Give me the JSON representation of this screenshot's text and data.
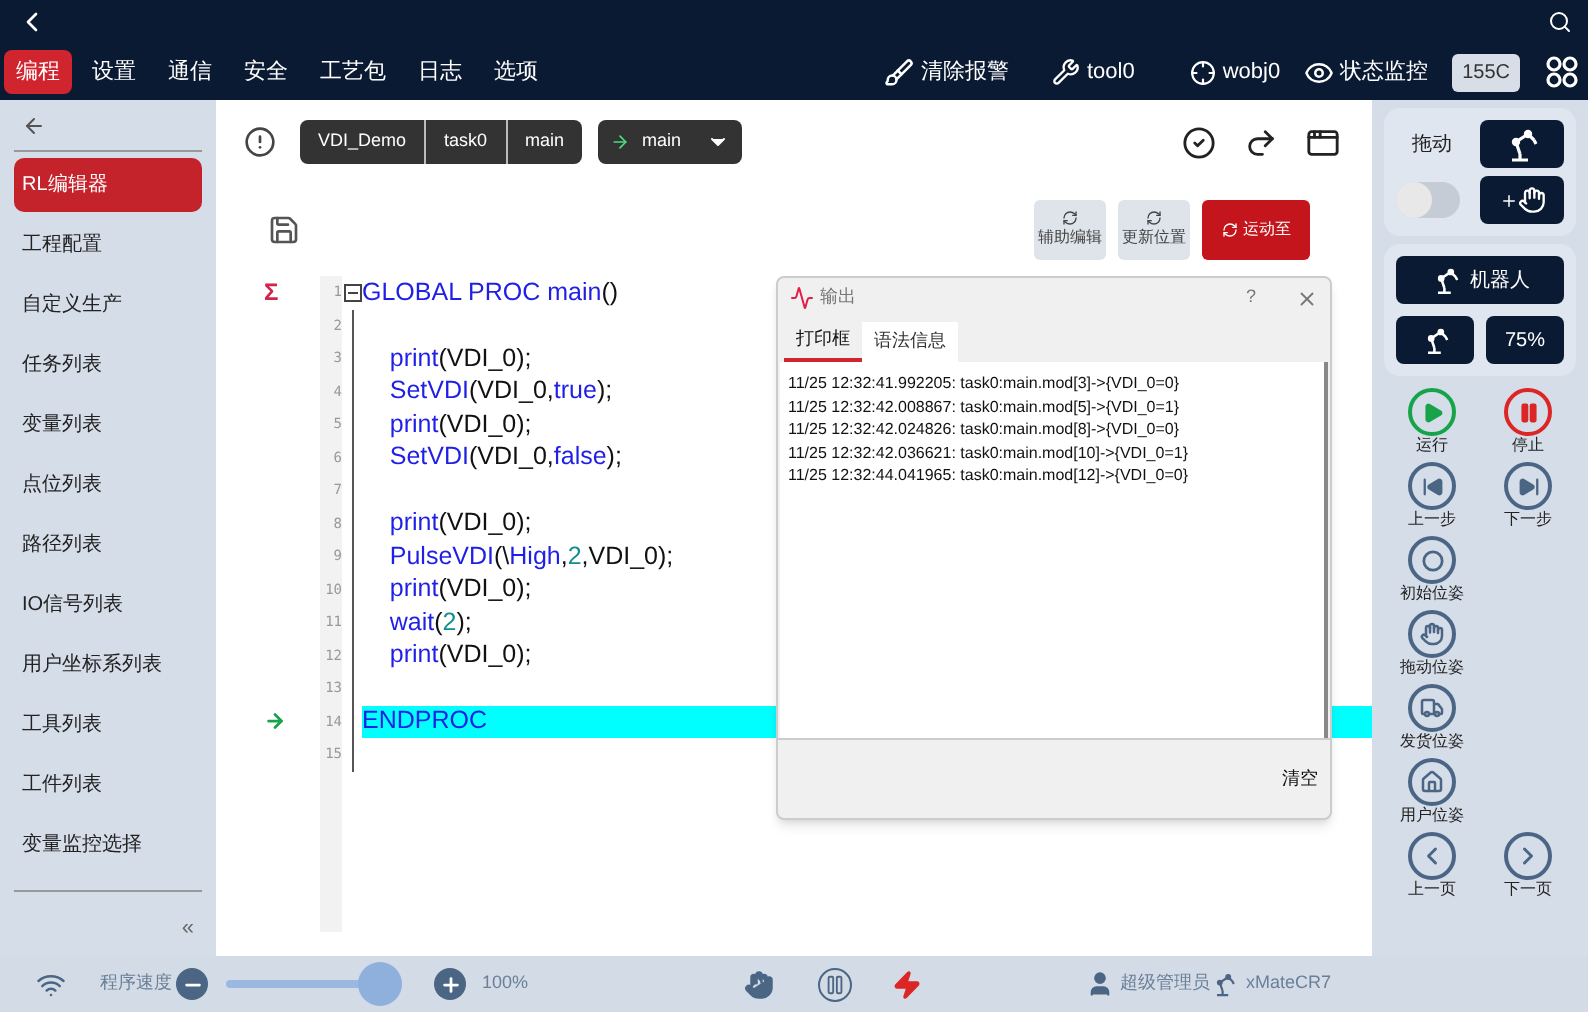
{
  "top_menu": [
    {
      "label": "编程",
      "selected": true
    },
    {
      "label": "设置",
      "selected": false
    },
    {
      "label": "通信",
      "selected": false
    },
    {
      "label": "安全",
      "selected": false
    },
    {
      "label": "工艺包",
      "selected": false
    },
    {
      "label": "日志",
      "selected": false
    },
    {
      "label": "选项",
      "selected": false
    }
  ],
  "top_status": {
    "clear_alarm": "清除报警",
    "tool": "tool0",
    "wobj": "wobj0",
    "monitor": "状态监控",
    "temperature": "155C"
  },
  "sidebar": {
    "items": [
      {
        "label": "RL编辑器",
        "selected": true
      },
      {
        "label": "工程配置",
        "selected": false
      },
      {
        "label": "自定义生产",
        "selected": false
      },
      {
        "label": "任务列表",
        "selected": false
      },
      {
        "label": "变量列表",
        "selected": false
      },
      {
        "label": "点位列表",
        "selected": false
      },
      {
        "label": "路径列表",
        "selected": false
      },
      {
        "label": "IO信号列表",
        "selected": false
      },
      {
        "label": "用户坐标系列表",
        "selected": false
      },
      {
        "label": "工具列表",
        "selected": false
      },
      {
        "label": "工件列表",
        "selected": false
      },
      {
        "label": "变量监控选择",
        "selected": false
      }
    ],
    "collapse": "«"
  },
  "breadcrumb": [
    "VDI_Demo",
    "task0",
    "main"
  ],
  "function_select": {
    "value": "main"
  },
  "editor_buttons": [
    {
      "label": "辅助编辑",
      "kind": "plain"
    },
    {
      "label": "更新位置",
      "kind": "plain"
    },
    {
      "label": "运动至",
      "kind": "primary"
    }
  ],
  "code_lines": [
    {
      "number": "1",
      "marker": "Σ",
      "current": false,
      "fold": true,
      "highlighted": false,
      "segments": [
        {
          "text": "GLOBAL PROC main",
          "kind": "kw"
        },
        {
          "text": "()",
          "kind": "plain"
        }
      ]
    },
    {
      "number": "2",
      "current": false,
      "fold": false,
      "highlighted": false
    },
    {
      "number": "3",
      "current": false,
      "fold": false,
      "highlighted": false,
      "segments": [
        {
          "text": "    print",
          "kind": "kw"
        },
        {
          "text": "(VDI_0);",
          "kind": "plain"
        }
      ]
    },
    {
      "number": "4",
      "current": false,
      "fold": false,
      "highlighted": false,
      "segments": [
        {
          "text": "    SetVDI",
          "kind": "kw"
        },
        {
          "text": "(VDI_0,",
          "kind": "plain"
        },
        {
          "text": "true",
          "kind": "kw"
        },
        {
          "text": ");",
          "kind": "plain"
        }
      ]
    },
    {
      "number": "5",
      "current": false,
      "fold": false,
      "highlighted": false,
      "segments": [
        {
          "text": "    print",
          "kind": "kw"
        },
        {
          "text": "(VDI_0);",
          "kind": "plain"
        }
      ]
    },
    {
      "number": "6",
      "current": false,
      "fold": false,
      "highlighted": false,
      "segments": [
        {
          "text": "    SetVDI",
          "kind": "kw"
        },
        {
          "text": "(VDI_0,",
          "kind": "plain"
        },
        {
          "text": "false",
          "kind": "kw"
        },
        {
          "text": ");",
          "kind": "plain"
        }
      ]
    },
    {
      "number": "7",
      "current": false,
      "fold": false,
      "highlighted": false
    },
    {
      "number": "8",
      "current": false,
      "fold": false,
      "highlighted": false,
      "segments": [
        {
          "text": "    print",
          "kind": "kw"
        },
        {
          "text": "(VDI_0);",
          "kind": "plain"
        }
      ]
    },
    {
      "number": "9",
      "current": false,
      "fold": false,
      "highlighted": false,
      "segments": [
        {
          "text": "    PulseVDI",
          "kind": "kw"
        },
        {
          "text": "(\\",
          "kind": "plain"
        },
        {
          "text": "High",
          "kind": "kw"
        },
        {
          "text": ",",
          "kind": "plain"
        },
        {
          "text": "2",
          "kind": "num"
        },
        {
          "text": ",VDI_0);",
          "kind": "plain"
        }
      ]
    },
    {
      "number": "10",
      "current": false,
      "fold": false,
      "highlighted": false,
      "segments": [
        {
          "text": "    print",
          "kind": "kw"
        },
        {
          "text": "(VDI_0);",
          "kind": "plain"
        }
      ]
    },
    {
      "number": "11",
      "current": false,
      "fold": false,
      "highlighted": false,
      "segments": [
        {
          "text": "    wait",
          "kind": "kw"
        },
        {
          "text": "(",
          "kind": "plain"
        },
        {
          "text": "2",
          "kind": "num"
        },
        {
          "text": ");",
          "kind": "plain"
        }
      ]
    },
    {
      "number": "12",
      "current": false,
      "fold": false,
      "highlighted": false,
      "segments": [
        {
          "text": "    print",
          "kind": "kw"
        },
        {
          "text": "(VDI_0);",
          "kind": "plain"
        }
      ]
    },
    {
      "number": "13",
      "current": false,
      "fold": false,
      "highlighted": false
    },
    {
      "number": "14",
      "current": true,
      "fold": false,
      "highlighted": true,
      "segments": [
        {
          "text": "ENDPROC",
          "kind": "kw"
        }
      ]
    },
    {
      "number": "15",
      "current": false,
      "fold": false,
      "highlighted": false
    }
  ],
  "output_dialog": {
    "title": "输出",
    "help": "?",
    "tabs": [
      {
        "label": "打印框",
        "selected": true
      },
      {
        "label": "语法信息",
        "selected": false
      }
    ],
    "lines": [
      "11/25 12:32:41.992205: task0:main.mod[3]->{VDI_0=0}",
      "11/25 12:32:42.008867: task0:main.mod[5]->{VDI_0=1}",
      "11/25 12:32:42.024826: task0:main.mod[8]->{VDI_0=0}",
      "11/25 12:32:42.036621: task0:main.mod[10]->{VDI_0=1}",
      "11/25 12:32:44.041965: task0:main.mod[12]->{VDI_0=0}"
    ],
    "clear": "清空"
  },
  "right_panel": {
    "drag_label": "拖动",
    "drag_on": false,
    "robot_label": "机器人",
    "speed": "75%",
    "controls": [
      {
        "label": "运行",
        "kind": "run"
      },
      {
        "label": "停止",
        "kind": "stop"
      },
      {
        "label": "上一步",
        "kind": "prev_step"
      },
      {
        "label": "下一步",
        "kind": "next_step"
      },
      {
        "label": "初始位姿",
        "kind": "init"
      },
      {
        "kind": "blank"
      },
      {
        "label": "拖动位姿",
        "kind": "drag"
      },
      {
        "kind": "blank"
      },
      {
        "label": "发货位姿",
        "kind": "ship"
      },
      {
        "kind": "blank"
      },
      {
        "label": "用户位姿",
        "kind": "home"
      },
      {
        "kind": "blank"
      },
      {
        "label": "上一页",
        "kind": "prev_page"
      },
      {
        "label": "下一页",
        "kind": "next_page"
      }
    ]
  },
  "bottom_bar": {
    "speed_label": "程序速度",
    "speed": {
      "level": 1.0
    },
    "speed_reading": "100%",
    "user": "超级管理员",
    "robot_model": "xMateCR7"
  }
}
